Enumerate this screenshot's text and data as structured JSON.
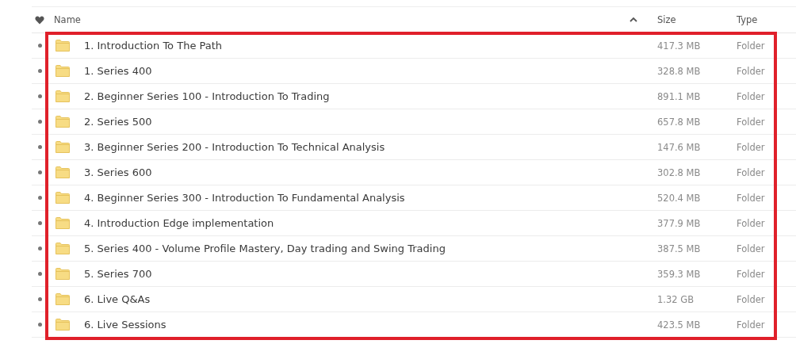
{
  "table": {
    "columns": [
      {
        "label": "Name",
        "sort_ascending": true
      },
      {
        "label": "Size"
      },
      {
        "label": "Type"
      }
    ],
    "rows": [
      {
        "name": "1. Introduction To The Path",
        "size": "417.3 MB",
        "type": "Folder"
      },
      {
        "name": "1. Series 400",
        "size": "328.8 MB",
        "type": "Folder"
      },
      {
        "name": "2. Beginner Series 100 - Introduction To Trading",
        "size": "891.1 MB",
        "type": "Folder"
      },
      {
        "name": "2. Series 500",
        "size": "657.8 MB",
        "type": "Folder"
      },
      {
        "name": "3. Beginner Series 200 - Introduction To Technical Analysis",
        "size": "147.6 MB",
        "type": "Folder"
      },
      {
        "name": "3. Series 600",
        "size": "302.8 MB",
        "type": "Folder"
      },
      {
        "name": "4. Beginner Series 300 - Introduction To Fundamental Analysis",
        "size": "520.4 MB",
        "type": "Folder"
      },
      {
        "name": "4. Introduction Edge implementation",
        "size": "377.9 MB",
        "type": "Folder"
      },
      {
        "name": "5. Series 400 - Volume Profile Mastery, Day trading and Swing Trading",
        "size": "387.5 MB",
        "type": "Folder"
      },
      {
        "name": "5. Series 700",
        "size": "359.3 MB",
        "type": "Folder"
      },
      {
        "name": "6. Live Q&As",
        "size": "1.32 GB",
        "type": "Folder"
      },
      {
        "name": "6. Live Sessions",
        "size": "423.5 MB",
        "type": "Folder"
      }
    ]
  }
}
